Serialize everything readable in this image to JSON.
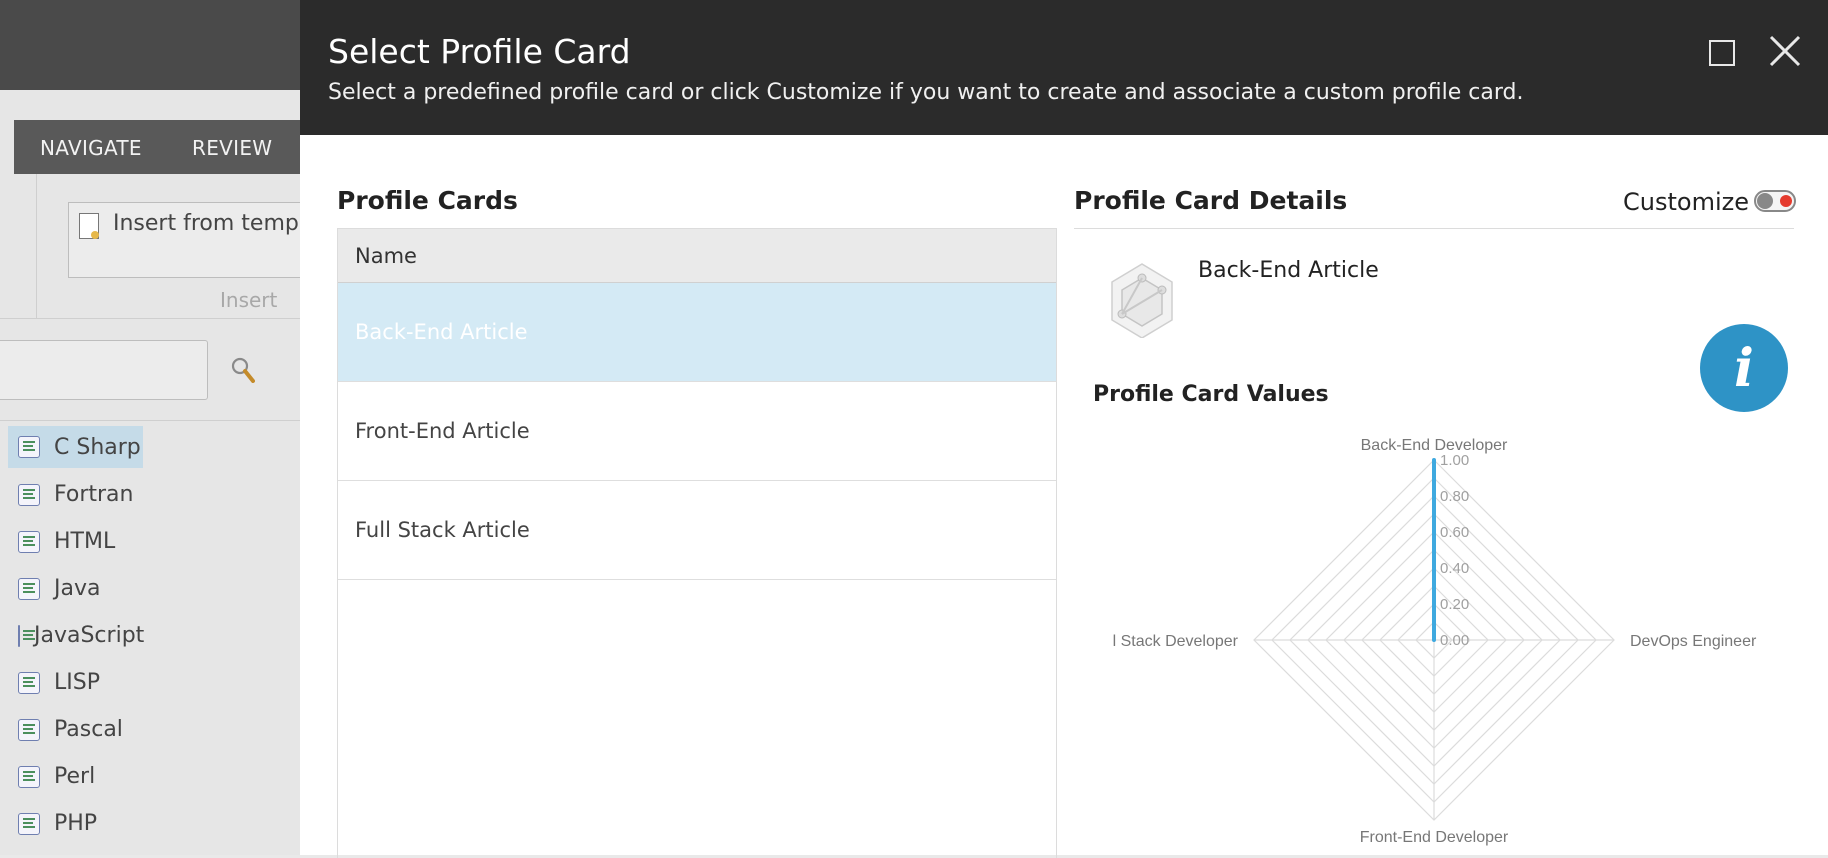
{
  "background_app": {
    "tabs": [
      "NAVIGATE",
      "REVIEW"
    ],
    "insert_button_label": "Insert from templa",
    "insert_group_caption": "Insert",
    "tree_items": [
      {
        "label": "C Sharp",
        "selected": true
      },
      {
        "label": "Fortran",
        "selected": false
      },
      {
        "label": "HTML",
        "selected": false
      },
      {
        "label": "Java",
        "selected": false
      },
      {
        "label": "JavaScript",
        "selected": false
      },
      {
        "label": "LISP",
        "selected": false
      },
      {
        "label": "Pascal",
        "selected": false
      },
      {
        "label": "Perl",
        "selected": false
      },
      {
        "label": "PHP",
        "selected": false
      }
    ]
  },
  "dialog": {
    "title": "Select Profile Card",
    "subtitle": "Select a predefined profile card or click Customize if you want to create and associate a custom profile card.",
    "profile_cards": {
      "title": "Profile Cards",
      "column_header": "Name",
      "rows": [
        {
          "name": "Back-End Article",
          "selected": true
        },
        {
          "name": "Front-End Article",
          "selected": false
        },
        {
          "name": "Full Stack Article",
          "selected": false
        }
      ]
    },
    "details": {
      "title": "Profile Card Details",
      "customize_label": "Customize",
      "customize_enabled": false,
      "card_name": "Back-End Article",
      "values_title": "Profile Card Values",
      "info_icon": "i"
    }
  },
  "chart_data": {
    "type": "radar",
    "axes": [
      "Back-End Developer",
      "DevOps Engineer",
      "Front-End Developer",
      "l Stack Developer"
    ],
    "ticks": [
      "0.00",
      "0.20",
      "0.40",
      "0.60",
      "0.80",
      "1.00"
    ],
    "range": [
      0,
      1
    ],
    "series": [
      {
        "values": [
          1.0,
          0,
          0,
          0
        ],
        "color": "#3fa9df"
      }
    ],
    "grid_color": "#dcdcdc"
  },
  "colors": {
    "header_bg": "#2b2b2b",
    "selected_row": "#d4eaf5",
    "accent": "#2e93c6",
    "toggle_dot": "#e53b2e"
  }
}
